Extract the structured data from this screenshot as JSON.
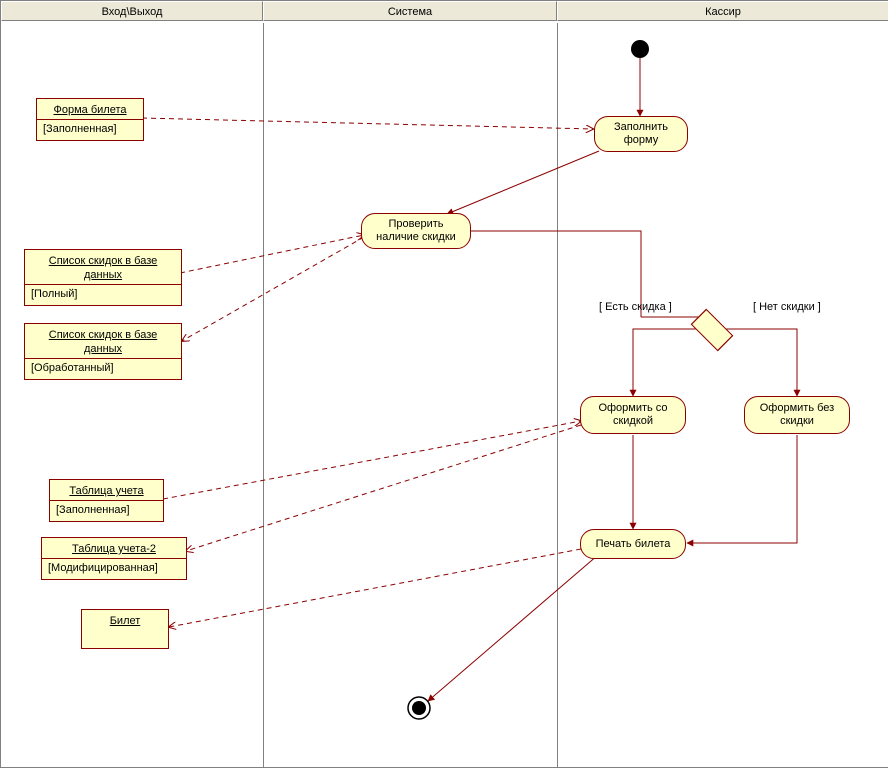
{
  "lanes": {
    "io": "Вход\\Выход",
    "system": "Система",
    "cashier": "Кассир"
  },
  "objects": {
    "ticket_form": {
      "title": "Форма билета",
      "state": "[Заполненная]"
    },
    "discount_list_full": {
      "title": "Список скидок в базе данных",
      "state": "[Полный]"
    },
    "discount_list_processed": {
      "title": "Список скидок в базе данных",
      "state": "[Обработанный]"
    },
    "account_table": {
      "title": "Таблица учета",
      "state": "[Заполненная]"
    },
    "account_table_2": {
      "title": "Таблица учета-2",
      "state": "[Модифицированная]"
    },
    "ticket": {
      "title": "Билет",
      "state": ""
    }
  },
  "activities": {
    "fill_form": "Заполнить форму",
    "check_discount": "Проверить наличие скидки",
    "issue_with_discount": "Оформить со скидкой",
    "issue_without_discount": "Оформить без скидки",
    "print_ticket": "Печать билета"
  },
  "guards": {
    "has_discount": "[ Есть скидка ]",
    "no_discount": "[ Нет скидки ]"
  }
}
